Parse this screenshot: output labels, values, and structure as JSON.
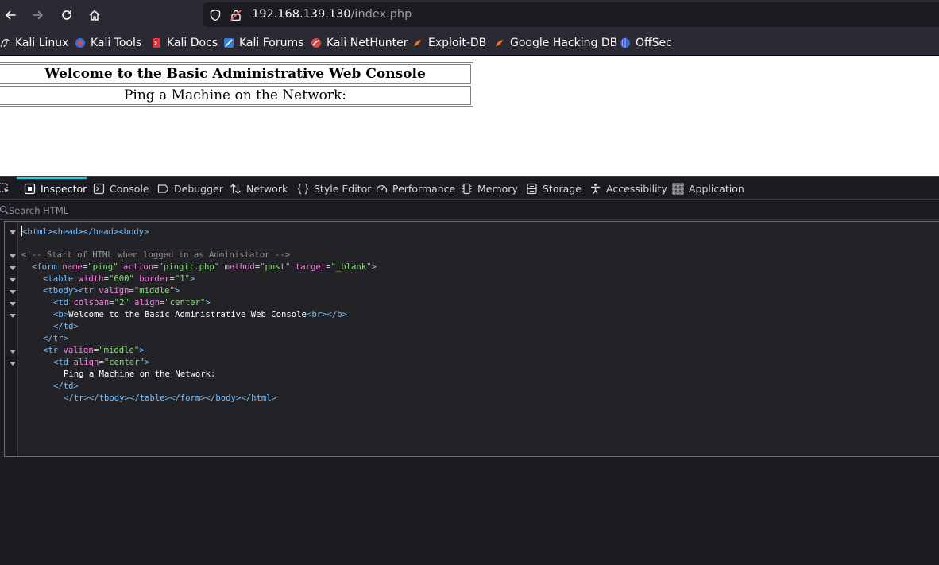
{
  "toolbar": {
    "back_icon": "arrow-left-icon",
    "forward_icon": "arrow-right-icon",
    "reload_icon": "reload-icon",
    "home_icon": "home-icon"
  },
  "urlbar": {
    "host": "192.168.139.130",
    "path": "/index.php",
    "shield_icon": "shield-icon",
    "insecure_icon": "insecure-lock-icon"
  },
  "bookmarks": [
    {
      "label": "Kali Linux",
      "icon": "kali-dragon-icon"
    },
    {
      "label": "Kali Tools",
      "icon": "kali-tools-icon"
    },
    {
      "label": "Kali Docs",
      "icon": "kali-docs-icon"
    },
    {
      "label": "Kali Forums",
      "icon": "kali-forums-icon"
    },
    {
      "label": "Kali NetHunter",
      "icon": "kali-nethunter-icon"
    },
    {
      "label": "Exploit-DB",
      "icon": "exploit-db-icon"
    },
    {
      "label": "Google Hacking DB",
      "icon": "ghdb-icon"
    },
    {
      "label": "OffSec",
      "icon": "offsec-icon"
    }
  ],
  "page": {
    "title": "Welcome to the Basic Administrative Web Console",
    "ping_label": "Ping a Machine on the Network:"
  },
  "devtools": {
    "tabs": [
      {
        "label": "Inspector",
        "icon": "inspector-icon",
        "active": true
      },
      {
        "label": "Console",
        "icon": "console-icon"
      },
      {
        "label": "Debugger",
        "icon": "debugger-icon"
      },
      {
        "label": "Network",
        "icon": "network-icon"
      },
      {
        "label": "Style Editor",
        "icon": "style-editor-icon"
      },
      {
        "label": "Performance",
        "icon": "performance-icon"
      },
      {
        "label": "Memory",
        "icon": "memory-icon"
      },
      {
        "label": "Storage",
        "icon": "storage-icon"
      },
      {
        "label": "Accessibility",
        "icon": "accessibility-icon"
      },
      {
        "label": "Application",
        "icon": "application-icon"
      }
    ],
    "search_placeholder": "Search HTML",
    "code": {
      "l1_html": "html",
      "l1_head": "head",
      "l1_head_close": "/head",
      "l1_body": "body",
      "comment": "<!-- Start of HTML when logged in as Administator -->",
      "form_tag": "form",
      "attr_name": "name",
      "val_ping": "\"ping\"",
      "attr_action": "action",
      "val_action": "\"pingit.php\"",
      "attr_method": "method",
      "val_method": "\"post\"",
      "attr_target": "target",
      "val_target": "\"_blank\"",
      "table_tag": "table",
      "attr_width": "width",
      "val_width": "\"600\"",
      "attr_border": "border",
      "val_border": "\"1\"",
      "tbody_tag": "tbody",
      "tr_tag": "tr",
      "attr_valign": "valign",
      "val_valign": "\"middle\"",
      "td_tag": "td",
      "attr_colspan": "colspan",
      "val_colspan": "\"2\"",
      "attr_align": "align",
      "val_align": "\"center\"",
      "b_tag": "b",
      "welcome_text": "Welcome to the Basic Administrative Web Console",
      "br_tag": "br",
      "b_close": "/b",
      "td_close": "/td",
      "tr_close": "/tr",
      "ping_text": "Ping a Machine on the Network:",
      "tbody_close": "/tbody",
      "table_close": "/table",
      "form_close": "/form",
      "body_close": "/body",
      "html_close": "/html"
    }
  },
  "colors": {
    "toolbar_bg": "#2b2a33",
    "devtools_bg": "#1c1b22",
    "tag": "#75bfff",
    "attr_name": "#ff7de9",
    "attr_value": "#86de74",
    "comment": "#939395",
    "active_tab_accent": "#00ddff"
  }
}
